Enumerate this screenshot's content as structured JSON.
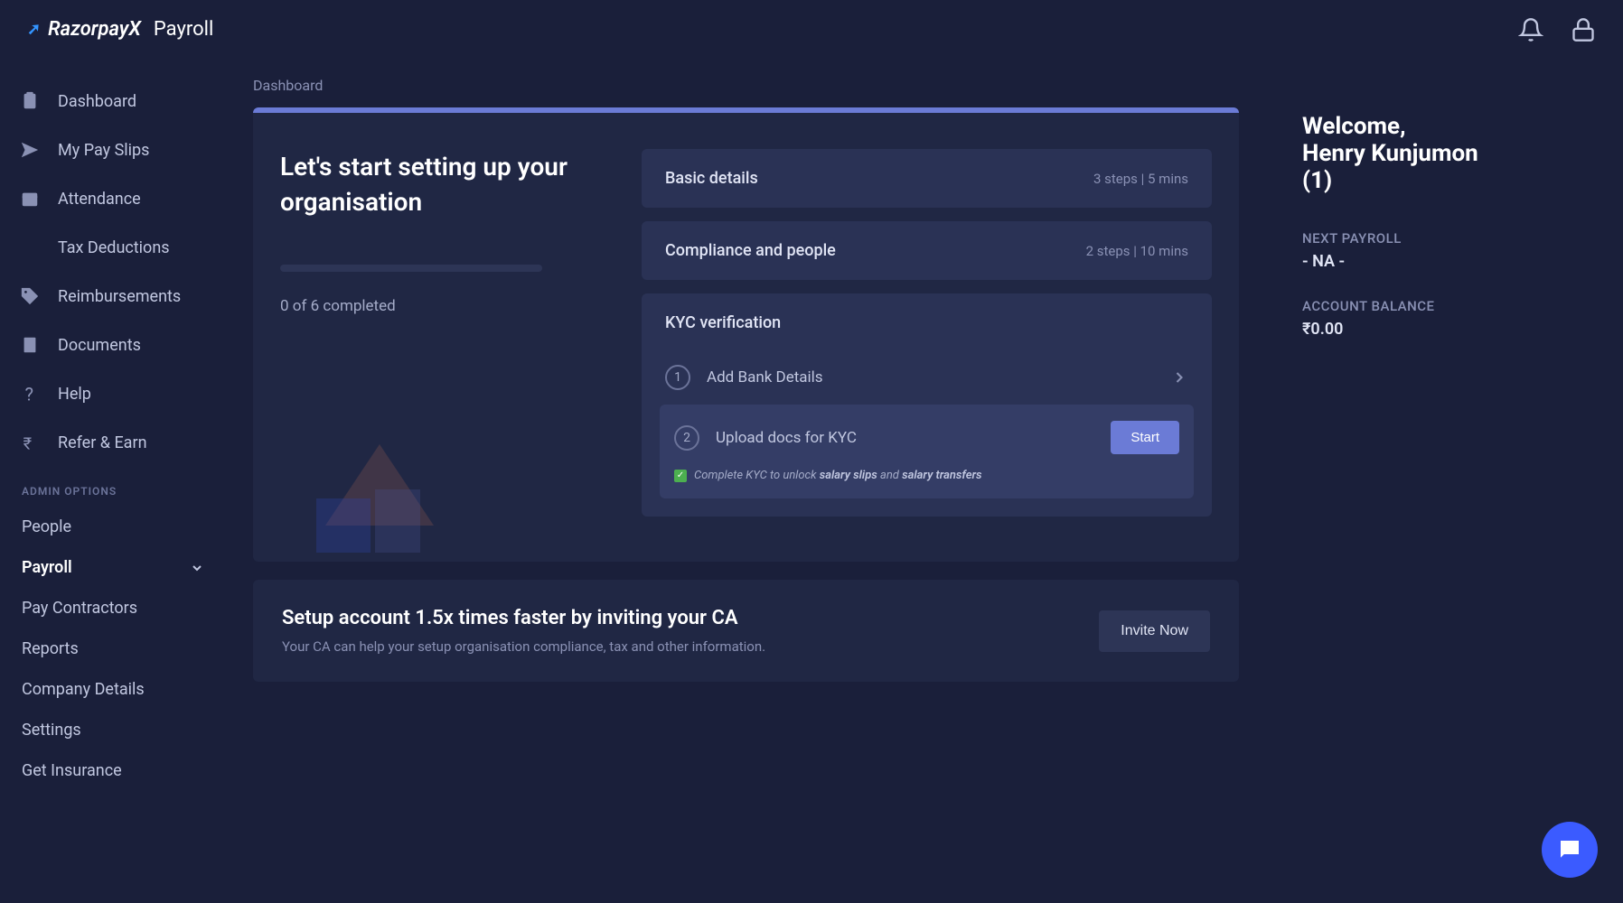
{
  "header": {
    "brand_prefix_arrow": "➚",
    "brand_name": "RazorpayX",
    "product": "Payroll"
  },
  "sidebar": {
    "items": [
      {
        "label": "Dashboard"
      },
      {
        "label": "My Pay Slips"
      },
      {
        "label": "Attendance"
      },
      {
        "label": "Tax Deductions"
      },
      {
        "label": "Reimbursements"
      },
      {
        "label": "Documents"
      },
      {
        "label": "Help"
      },
      {
        "label": "Refer & Earn"
      }
    ],
    "admin_label": "ADMIN OPTIONS",
    "admin_items": [
      {
        "label": "People"
      },
      {
        "label": "Payroll",
        "active": true,
        "expandable": true
      },
      {
        "label": "Pay Contractors"
      },
      {
        "label": "Reports"
      },
      {
        "label": "Company Details"
      },
      {
        "label": "Settings"
      },
      {
        "label": "Get Insurance"
      }
    ]
  },
  "breadcrumb": "Dashboard",
  "setup": {
    "title": "Let's start setting up your organisation",
    "progress_text": "0 of 6 completed",
    "steps": [
      {
        "title": "Basic details",
        "meta": "3 steps | 5 mins"
      },
      {
        "title": "Compliance and people",
        "meta": "2 steps | 10 mins"
      }
    ],
    "kyc": {
      "title": "KYC verification",
      "rows": [
        {
          "num": "1",
          "label": "Add Bank Details"
        },
        {
          "num": "2",
          "label": "Upload docs for KYC",
          "start_label": "Start"
        }
      ],
      "note_prefix": "Complete KYC to unlock ",
      "note_bold1": "salary slips",
      "note_mid": " and ",
      "note_bold2": "salary transfers"
    }
  },
  "ca": {
    "title": "Setup account 1.5x times faster by inviting your CA",
    "sub": "Your CA can help your setup organisation compliance, tax and other information.",
    "button": "Invite Now"
  },
  "right": {
    "welcome": "Welcome,",
    "name": "Henry Kunjumon",
    "id": "(1)",
    "next_payroll_label": "NEXT PAYROLL",
    "next_payroll_value": "- NA -",
    "balance_label": "ACCOUNT BALANCE",
    "balance_value": "₹0.00"
  }
}
